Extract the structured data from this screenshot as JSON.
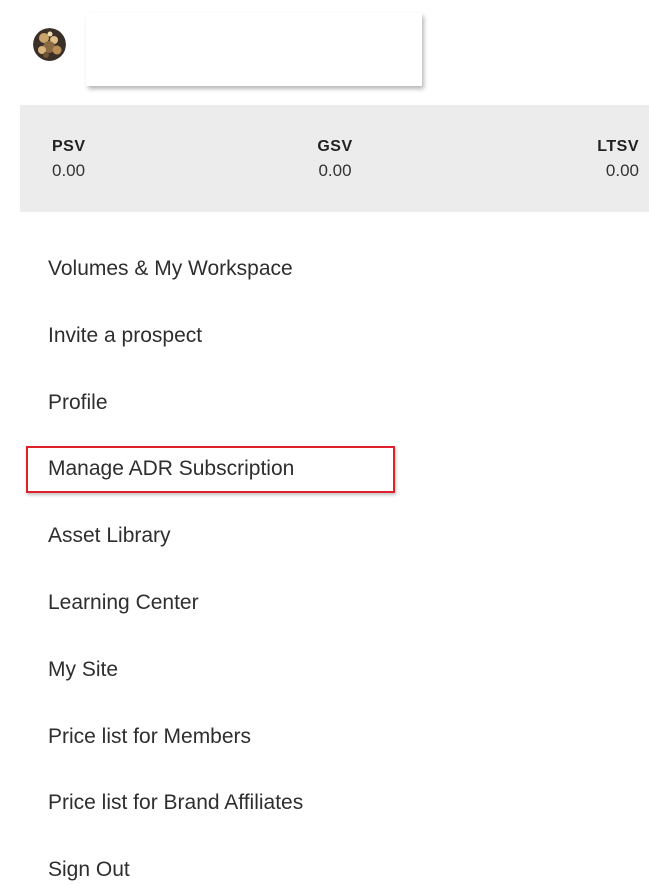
{
  "profile": {
    "avatar_icon": "user-photo-avatar",
    "name": ""
  },
  "volumes": [
    {
      "label": "PSV",
      "value": "0.00"
    },
    {
      "label": "GSV",
      "value": "0.00"
    },
    {
      "label": "LTSV",
      "value": "0.00"
    }
  ],
  "menu": {
    "items": [
      {
        "label": "Volumes & My Workspace"
      },
      {
        "label": "Invite a prospect"
      },
      {
        "label": "Profile"
      },
      {
        "label": "Manage ADR Subscription",
        "highlighted": true
      },
      {
        "label": "Asset Library"
      },
      {
        "label": "Learning Center"
      },
      {
        "label": "My Site"
      },
      {
        "label": "Price list for Members"
      },
      {
        "label": "Price list for Brand Affiliates"
      },
      {
        "label": "Sign Out"
      }
    ]
  },
  "colors": {
    "highlight_border": "#e0202a",
    "volumes_background": "#ececec",
    "text": "#2e2e2e"
  }
}
